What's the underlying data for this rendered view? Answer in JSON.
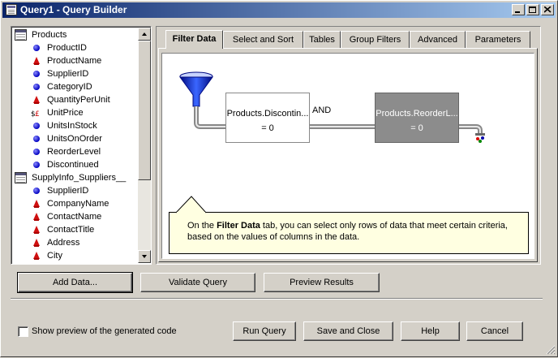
{
  "window": {
    "title": "Query1 - Query Builder",
    "controls": [
      "minimize",
      "maximize",
      "close"
    ]
  },
  "tree": {
    "tables": [
      {
        "name": "Products",
        "fields": [
          {
            "name": "ProductID",
            "icon": "key-icon"
          },
          {
            "name": "ProductName",
            "icon": "text-field-icon"
          },
          {
            "name": "SupplierID",
            "icon": "key-icon"
          },
          {
            "name": "CategoryID",
            "icon": "key-icon"
          },
          {
            "name": "QuantityPerUnit",
            "icon": "text-field-icon"
          },
          {
            "name": "UnitPrice",
            "icon": "currency-field-icon"
          },
          {
            "name": "UnitsInStock",
            "icon": "key-icon"
          },
          {
            "name": "UnitsOnOrder",
            "icon": "key-icon"
          },
          {
            "name": "ReorderLevel",
            "icon": "key-icon"
          },
          {
            "name": "Discontinued",
            "icon": "key-icon"
          }
        ]
      },
      {
        "name": "SupplyInfo_Suppliers__",
        "fields": [
          {
            "name": "SupplierID",
            "icon": "key-icon"
          },
          {
            "name": "CompanyName",
            "icon": "text-field-icon"
          },
          {
            "name": "ContactName",
            "icon": "text-field-icon"
          },
          {
            "name": "ContactTitle",
            "icon": "text-field-icon"
          },
          {
            "name": "Address",
            "icon": "text-field-icon"
          },
          {
            "name": "City",
            "icon": "text-field-icon"
          }
        ]
      }
    ]
  },
  "tabs": [
    {
      "label": "Filter Data",
      "active": true
    },
    {
      "label": "Select and Sort",
      "active": false
    },
    {
      "label": "Tables",
      "active": false
    },
    {
      "label": "Group Filters",
      "active": false
    },
    {
      "label": "Advanced",
      "active": false
    },
    {
      "label": "Parameters",
      "active": false
    }
  ],
  "filter": {
    "conditions": [
      {
        "column": "Products.Discontin...",
        "value": "= 0",
        "selected": false
      },
      {
        "column": "Products.ReorderL...",
        "value": "= 0",
        "selected": true
      }
    ],
    "operator": "AND"
  },
  "tooltip": {
    "prefix": "On the ",
    "bold": "Filter Data",
    "rest": " tab, you can select only rows of data that meet certain criteria, based on the values of columns in the data."
  },
  "actions": {
    "add_data": "Add Data...",
    "validate": "Validate Query",
    "preview": "Preview Results"
  },
  "footer": {
    "show_preview_label": "Show preview of the generated code",
    "show_preview_checked": false,
    "run_query": "Run Query",
    "save_close": "Save and Close",
    "help": "Help",
    "cancel": "Cancel"
  },
  "colors": {
    "titlebar_start": "#0a246a",
    "titlebar_end": "#a6caf0",
    "tooltip_bg": "#ffffe1",
    "selected_condition": "#8c8c8c",
    "funnel_blue": "#1a3fd0"
  }
}
